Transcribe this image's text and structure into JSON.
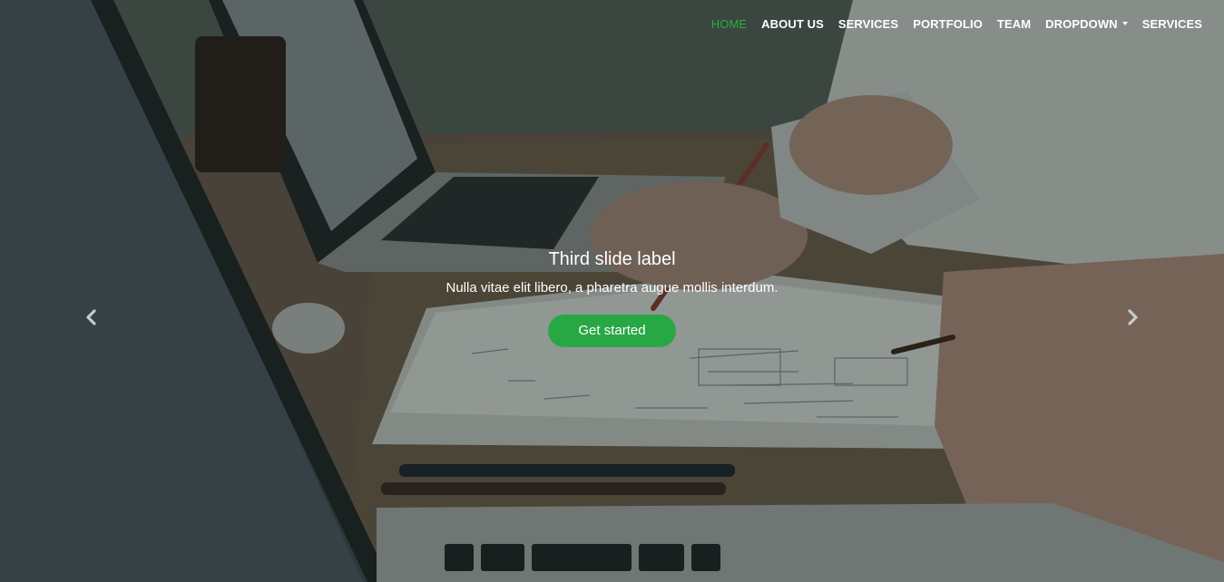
{
  "nav": {
    "items": [
      {
        "label": "HOME",
        "active": true
      },
      {
        "label": "ABOUT US"
      },
      {
        "label": "SERVICES"
      },
      {
        "label": "PORTFOLIO"
      },
      {
        "label": "TEAM"
      },
      {
        "label": "DROPDOWN",
        "has_caret": true
      },
      {
        "label": "SERVICES"
      }
    ],
    "active_color": "#24b13c"
  },
  "slide": {
    "title": "Third slide label",
    "text": "Nulla vitae elit libero, a pharetra augue mollis interdum.",
    "cta_label": "Get started",
    "cta_color": "#28a745"
  },
  "controls": {
    "prev_icon": "chevron-left-icon",
    "next_icon": "chevron-right-icon"
  }
}
